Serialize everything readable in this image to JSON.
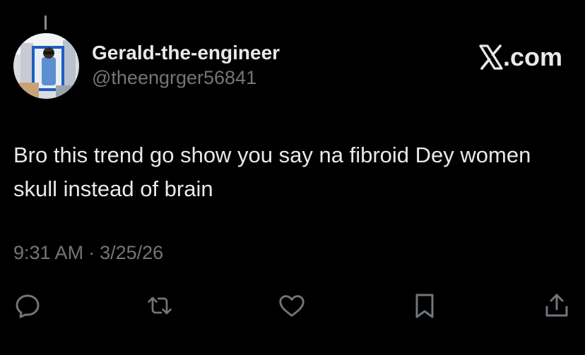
{
  "colors": {
    "background": "#000000",
    "text_primary": "#e7e9ea",
    "text_secondary": "#71767b"
  },
  "author": {
    "display_name": "Gerald-the-engineer",
    "handle": "@theengrger56841"
  },
  "brand": {
    "label": ".com",
    "icon": "x-logo-icon"
  },
  "tweet": {
    "text": "Bro this trend go show you say na fibroid Dey women skull instead of brain",
    "time": "9:31 AM",
    "separator": "·",
    "date": "3/25/26"
  },
  "actions": [
    {
      "name": "reply",
      "icon": "reply-icon"
    },
    {
      "name": "retweet",
      "icon": "retweet-icon"
    },
    {
      "name": "like",
      "icon": "heart-icon"
    },
    {
      "name": "bookmark",
      "icon": "bookmark-icon"
    },
    {
      "name": "share",
      "icon": "share-icon"
    }
  ]
}
